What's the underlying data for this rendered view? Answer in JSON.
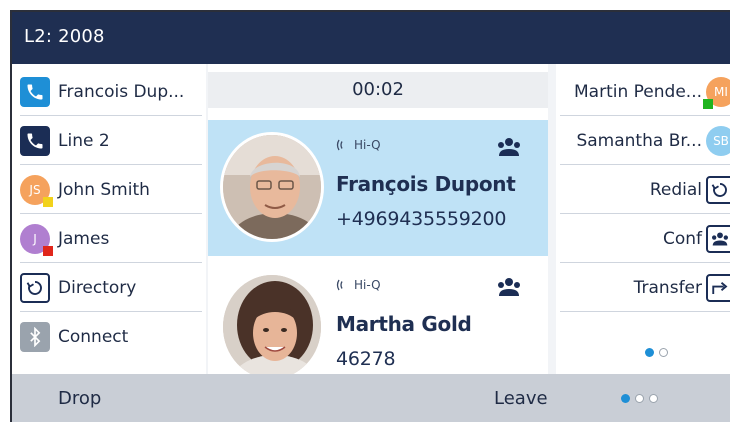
{
  "top_bar": {
    "title": "L2: 2008"
  },
  "left_keys": [
    {
      "label": "Francois Dup...",
      "icon": "phone-icon",
      "icon_color": "#1e8fd6"
    },
    {
      "label": "Line 2",
      "icon": "phone-icon",
      "icon_color": "#1b2d55"
    },
    {
      "label": "John Smith",
      "avatar_initials": "JS",
      "avatar_color": "#f5a25d",
      "presence_color": "#f2d21b"
    },
    {
      "label": "James",
      "avatar_initials": "J",
      "avatar_color": "#b07fd0",
      "presence_color": "#e0261b"
    },
    {
      "label": "Directory",
      "icon": "directory-icon"
    },
    {
      "label": "Connect",
      "icon": "bluetooth-icon",
      "icon_color": "#9aa3ad"
    }
  ],
  "center": {
    "timer": "00:02",
    "calls": [
      {
        "codec": "Hi-Q",
        "name": "François Dupont",
        "number": "+4969435559200",
        "active": true
      },
      {
        "codec": "Hi-Q",
        "name": "Martha Gold",
        "number": "46278",
        "active": false
      }
    ]
  },
  "right_keys": [
    {
      "label": "Martin Pende...",
      "avatar_initials": "MI",
      "avatar_color": "#f5a25d",
      "presence_color": "#1fb41f"
    },
    {
      "label": "Samantha Br...",
      "avatar_initials": "SB",
      "avatar_color": "#8fcdf0"
    },
    {
      "label": "Redial",
      "icon": "redial-icon"
    },
    {
      "label": "Conf",
      "icon": "conference-icon"
    },
    {
      "label": "Transfer",
      "icon": "transfer-icon"
    }
  ],
  "right_page_dots": {
    "count": 2,
    "active": 0
  },
  "softkeys": {
    "drop": "Drop",
    "leave": "Leave"
  },
  "softkey_page_dots": {
    "count": 3,
    "active": 0
  },
  "colors": {
    "header": "#1f2f52",
    "active_call": "#bfe2f6",
    "accent": "#1e8fd6",
    "softkey_bar": "#c9ced6"
  }
}
